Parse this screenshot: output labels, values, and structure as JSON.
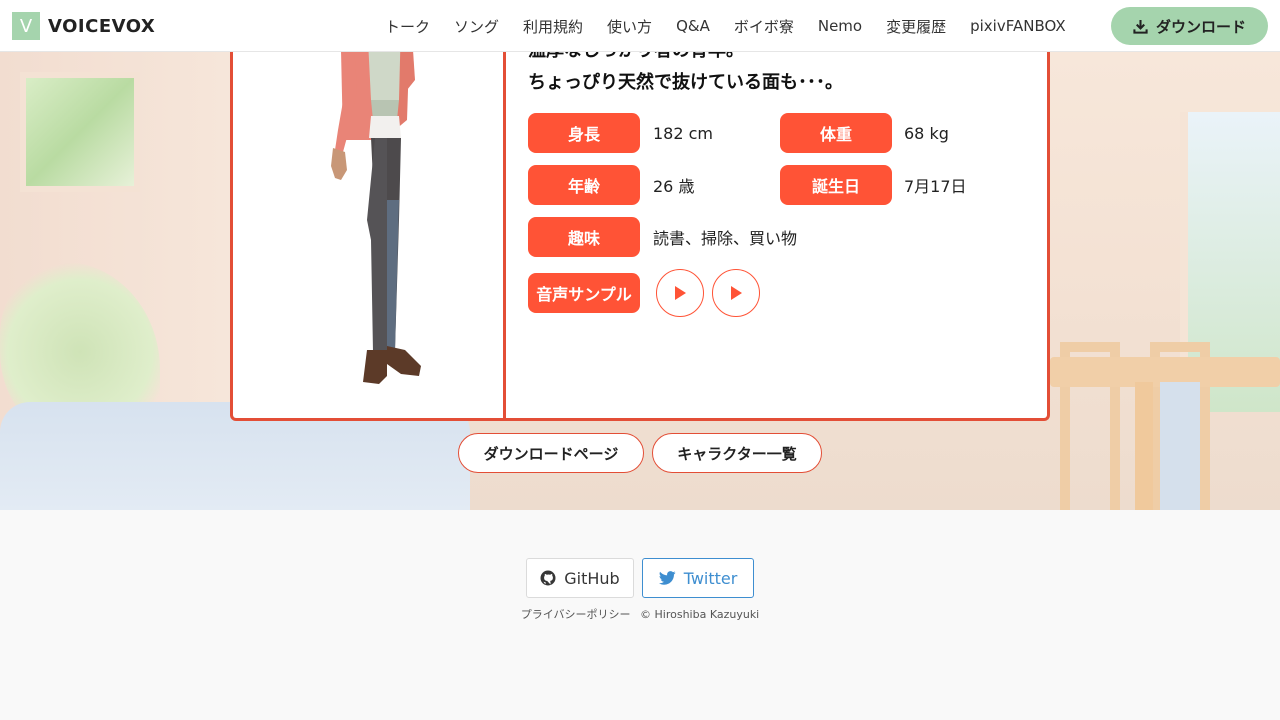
{
  "header": {
    "logo_letter": "V",
    "logo_text": "VOICEVOX",
    "nav": [
      "トーク",
      "ソング",
      "利用規約",
      "使い方",
      "Q&A",
      "ボイボ寮",
      "Nemo",
      "変更履歴",
      "pixivFANBOX"
    ],
    "download_label": "ダウンロード"
  },
  "profile": {
    "desc_line1": "温厚なしっかり者の青年。",
    "desc_line2": "ちょっぴり天然で抜けている面も･･･。",
    "height_label": "身長",
    "height_value": "182 cm",
    "weight_label": "体重",
    "weight_value": "68 kg",
    "age_label": "年齢",
    "age_value": "26 歳",
    "birthday_label": "誕生日",
    "birthday_value": "7月17日",
    "hobby_label": "趣味",
    "hobby_value": "読書、掃除、買い物",
    "sample_label": "音声サンプル"
  },
  "links": {
    "download_page": "ダウンロードページ",
    "character_list": "キャラクター一覧"
  },
  "footer": {
    "github": "GitHub",
    "twitter": "Twitter",
    "privacy": "プライバシーポリシー",
    "copyright": "© Hiroshiba Kazuyuki"
  },
  "colors": {
    "accent": "#ff5336",
    "brand_green": "#a5d4ad",
    "twitter_blue": "#3e8ed0"
  }
}
